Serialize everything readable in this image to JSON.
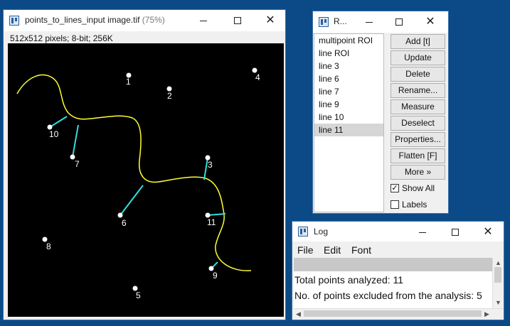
{
  "image_window": {
    "title": "points_to_lines_input image.tif",
    "zoom": "(75%)",
    "info": "512x512 pixels; 8-bit; 256K",
    "points": [
      {
        "label": "1"
      },
      {
        "label": "2"
      },
      {
        "label": "3"
      },
      {
        "label": "4"
      },
      {
        "label": "5"
      },
      {
        "label": "6"
      },
      {
        "label": "7"
      },
      {
        "label": "8"
      },
      {
        "label": "9"
      },
      {
        "label": "10"
      },
      {
        "label": "11"
      }
    ],
    "colors": {
      "curve": "#ffff33",
      "lines": "#33dddd",
      "points": "#ffffff",
      "background": "#000000"
    }
  },
  "roi_manager": {
    "title": "R...",
    "items": [
      "multipoint ROI",
      "line ROI",
      "line 3",
      "line 6",
      "line 7",
      "line 9",
      "line 10",
      "line 11"
    ],
    "selected_index": 7,
    "buttons": {
      "add": "Add [t]",
      "update": "Update",
      "delete": "Delete",
      "rename": "Rename...",
      "measure": "Measure",
      "deselect": "Deselect",
      "properties": "Properties...",
      "flatten": "Flatten [F]",
      "more": "More »"
    },
    "show_all": {
      "label": "Show All",
      "checked": true
    },
    "labels": {
      "label": "Labels",
      "checked": false
    }
  },
  "log_window": {
    "title": "Log",
    "menu": [
      "File",
      "Edit",
      "Font"
    ],
    "lines": [
      "Total points analyzed: 11",
      "No. of points excluded from the analysis: 5"
    ]
  },
  "window_controls": {
    "minimize": "—",
    "maximize": "☐",
    "close": "✕"
  }
}
